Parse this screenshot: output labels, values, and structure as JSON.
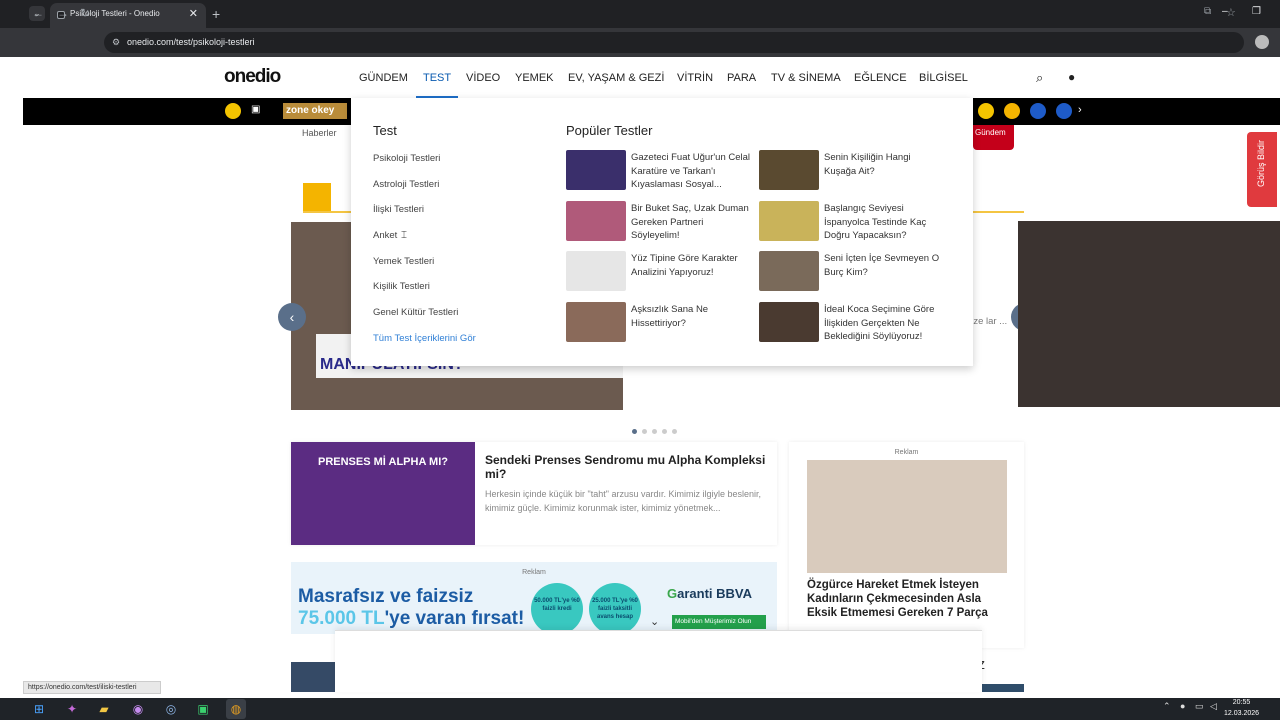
{
  "browser": {
    "tab_title": "Psikoloji Testleri - Onedio",
    "new_tab": "+",
    "url": "onedio.com/test/psikoloji-testleri",
    "status_url": "https://onedio.com/test/iliski-testleri"
  },
  "site": {
    "logo": "onedio",
    "nav": [
      "GÜNDEM",
      "TEST",
      "VİDEO",
      "YEMEK",
      "EV, YAŞAM & GEZİ",
      "VİTRİN",
      "PARA",
      "TV & SİNEMA",
      "EĞLENCE",
      "BİLGİSEL"
    ],
    "active_nav": "TEST",
    "zone_banner": "zone okey",
    "breadcrumb": "Haberler",
    "red_tab": "Gündem",
    "feedback": "Görüş Bildir"
  },
  "dropdown": {
    "title": "Test",
    "links": [
      "Psikoloji Testleri",
      "Astroloji Testleri",
      "İlişki Testleri",
      "Anket",
      "Yemek Testleri",
      "Kişilik Testleri",
      "Genel Kültür Testleri"
    ],
    "all_link": "Tüm Test İçeriklerini Gör",
    "popular_title": "Popüler Testler",
    "popular": [
      {
        "text": "Gazeteci Fuat Uğur'un Celal Karatüre ve Tarkan'ı Kıyaslaması Sosyal...",
        "color": "#3a2f6b"
      },
      {
        "text": "Senin Kişiliğin Hangi Kuşağa Ait?",
        "color": "#5a4a30"
      },
      {
        "text": "Bir Buket Saç, Uzak Duman Gereken Partneri Söyleyelim!",
        "color": "#b05a7a"
      },
      {
        "text": "Başlangıç Seviyesi İspanyolca Testinde Kaç Doğru Yapacaksın?",
        "color": "#c9b35a"
      },
      {
        "text": "Yüz Tipine Göre Karakter Analizini Yapıyoruz!",
        "color": "#e6e6e6"
      },
      {
        "text": "Seni İçten İçe Sevmeyen O Burç Kim?",
        "color": "#7a6a5a"
      },
      {
        "text": "Aşksızlık Sana Ne Hissettiriyor?",
        "color": "#8a6a5a"
      },
      {
        "text": "İdeal Koca Seçimine Göre İlişkiden Gerçekten Ne Beklediğini Söylüyoruz!",
        "color": "#4a3a30"
      }
    ]
  },
  "hero": {
    "label": "MANİPÜLATİFSİN?",
    "behind_text": "ain ze lar ..."
  },
  "card": {
    "tag": "PRENSES Mİ ALPHA MI?",
    "title": "Sendeki Prenses Sendromu mu Alpha Kompleksi mi?",
    "desc": "Herkesin içinde küçük bir \"taht\" arzusu vardır. Kimimiz ilgiyle beslenir, kimimiz güçle. Kimimiz korunmak ister, kimimiz yönetmek..."
  },
  "ad_right": {
    "label": "Reklam",
    "title": "Özgürce Hareket Etmek İsteyen Kadınların Çekmecesinden Asla Eksik Etmemesi Gereken 7 Parça"
  },
  "ad_left": {
    "label": "Reklam",
    "line1": "Masrafsız ve faizsiz",
    "line2_amount": "75.000 TL",
    "line2_rest": "'ye varan fırsat!",
    "bubble1": "50.000 TL'ye %0 faizli kredi",
    "bubble2": "25.000 TL'ye %0 faizli taksitli avans hesap",
    "brand_g": "G",
    "brand": "aranti BBVA",
    "button": "Mobil'den Müşterimiz Olun"
  },
  "bottom_heading": "niz",
  "taskbar": {
    "time": "20:55",
    "date": "12.03.2026"
  }
}
